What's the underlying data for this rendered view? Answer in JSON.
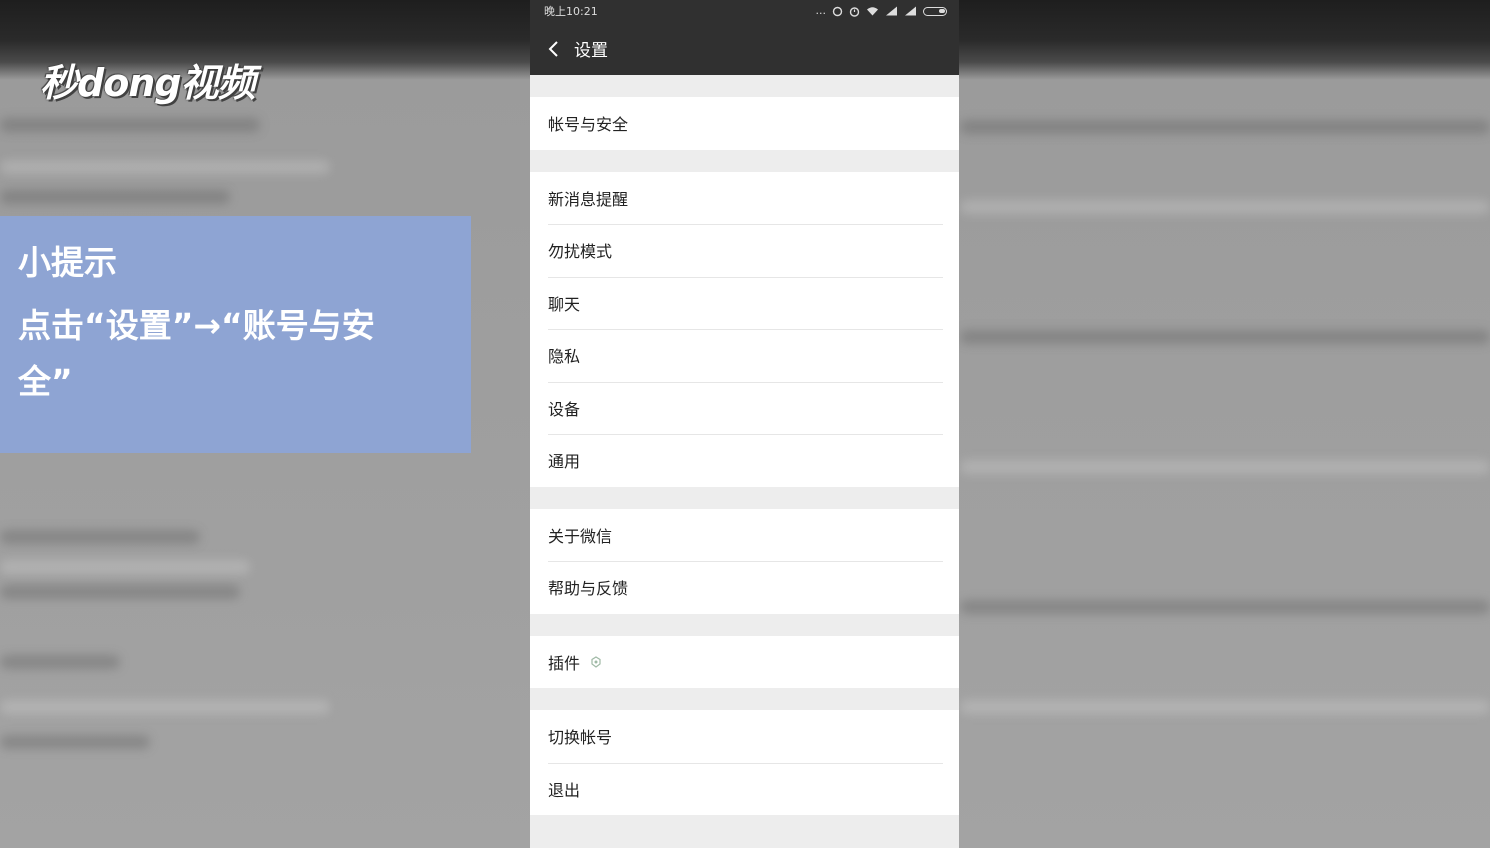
{
  "overlay": {
    "logo_text": "秒dong视频",
    "tip_title": "小提示",
    "tip_body": "点击“设置”→“账号与安全”"
  },
  "status_bar": {
    "time": "晚上10:21",
    "dots": "..."
  },
  "header": {
    "title": "设置",
    "back_icon": "chevron-left-icon"
  },
  "groups": [
    {
      "items": [
        "帐号与安全"
      ]
    },
    {
      "items": [
        "新消息提醒",
        "勿扰模式",
        "聊天",
        "隐私",
        "设备",
        "通用"
      ]
    },
    {
      "items": [
        "关于微信",
        "帮助与反馈"
      ]
    },
    {
      "items": [
        "插件"
      ]
    },
    {
      "items": [
        "切换帐号",
        "退出"
      ]
    }
  ],
  "colors": {
    "header_bg": "#303030",
    "list_bg": "#ffffff",
    "page_bg": "#ededed",
    "tip_bg": "#8ea4d3"
  }
}
